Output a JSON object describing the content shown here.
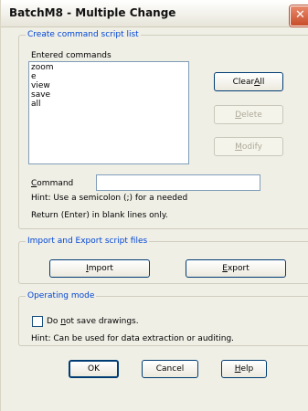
{
  "window": {
    "title": "BatchM8 - Multiple Change",
    "close_symbol": "✕"
  },
  "create": {
    "legend": "Create command script list",
    "entered_label": "Entered commands",
    "commands": [
      "zoom",
      "e",
      "view",
      "save",
      "all"
    ],
    "clear_all": {
      "pre": "Clear ",
      "u": "A",
      "post": "ll"
    },
    "delete": {
      "pre": "",
      "u": "D",
      "post": "elete"
    },
    "modify": {
      "pre": "",
      "u": "M",
      "post": "odify"
    },
    "command_label": {
      "pre": "",
      "u": "C",
      "post": "ommand"
    },
    "command_value": "",
    "hint1": "Hint: Use a semicolon (;) for a needed",
    "hint2": "Return (Enter) in blank lines only."
  },
  "import_export": {
    "legend": "Import and Export script files",
    "import": {
      "pre": "",
      "u": "I",
      "post": "mport"
    },
    "export": {
      "pre": "",
      "u": "E",
      "post": "xport"
    }
  },
  "operating": {
    "legend": "Operating mode",
    "checkbox": {
      "pre": "Do ",
      "u": "n",
      "post": "ot save drawings.",
      "checked": false
    },
    "hint": "Hint: Can be used for data extraction or auditing."
  },
  "footer": {
    "ok": "OK",
    "cancel": "Cancel",
    "help": {
      "pre": "",
      "u": "H",
      "post": "elp"
    }
  }
}
